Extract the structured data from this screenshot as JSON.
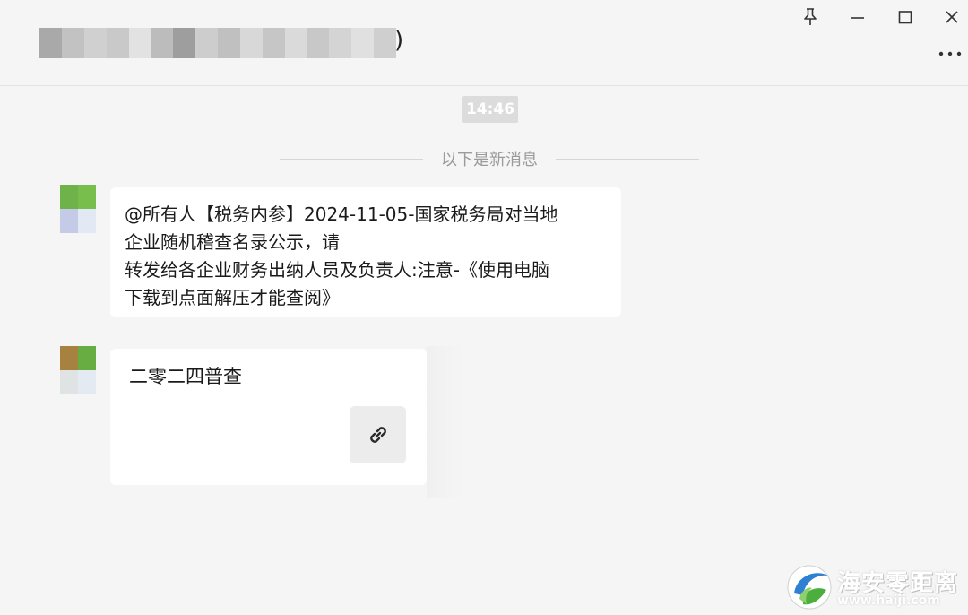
{
  "window": {
    "title_suffix": ")",
    "buttons": {
      "pin": "pin-icon",
      "minimize": "minimize-icon",
      "maximize": "maximize-icon",
      "close": "close-icon",
      "more": "more-icon"
    }
  },
  "chat": {
    "time": "14:46",
    "new_messages_divider": "以下是新消息",
    "messages": [
      {
        "lines": [
          "@所有人【税务内参】2024-11-05-国家税务局对当地",
          "企业随机稽查名录公示，请",
          "转发给各企业财务出纳人员及负责人:注意-《使用电脑",
          "下载到点面解压才能查阅》"
        ]
      },
      {
        "card_title": "二零二四普查",
        "card_icon": "link-icon"
      }
    ]
  },
  "watermark": {
    "name": "海安零距离",
    "url": "www.haiji.com"
  },
  "colors": {
    "background": "#f5f5f5",
    "bubble": "#ffffff",
    "time_chip": "#dcdcdc"
  }
}
